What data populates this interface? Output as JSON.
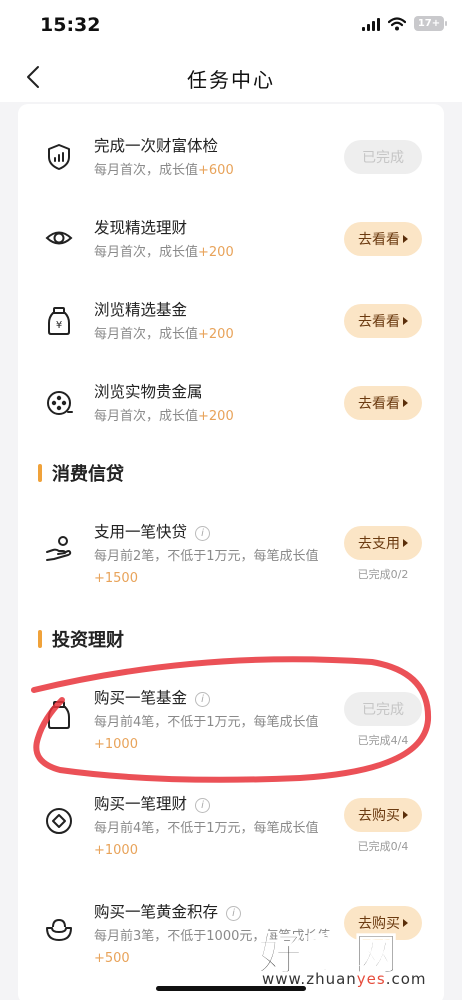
{
  "status_bar": {
    "time": "15:32",
    "battery": "17+"
  },
  "nav": {
    "title": "任务中心"
  },
  "sections": {
    "consumer_credit": "消费信贷",
    "investment": "投资理财"
  },
  "tasks": [
    {
      "title": "完成一次财富体检",
      "desc": "每月首次，成长值",
      "reward": "+600",
      "button": "已完成",
      "icon": "shield-chart-icon"
    },
    {
      "title": "发现精选理财",
      "desc": "每月首次，成长值",
      "reward": "+200",
      "button": "去看看",
      "icon": "eye-icon"
    },
    {
      "title": "浏览精选基金",
      "desc": "每月首次，成长值",
      "reward": "+200",
      "button": "去看看",
      "icon": "money-jar-icon"
    },
    {
      "title": "浏览实物贵金属",
      "desc": "每月首次，成长值",
      "reward": "+200",
      "button": "去看看",
      "icon": "film-reel-icon"
    },
    {
      "title": "支用一笔快贷",
      "desc": "每月前2笔，不低于1万元，每笔成长值",
      "reward": "+1500",
      "button": "去支用",
      "progress": "已完成0/2",
      "icon": "hand-coin-icon"
    },
    {
      "title": "购买一笔基金",
      "desc": "每月前4笔，不低于1万元，每笔成长值",
      "reward": "+1000",
      "button": "已完成",
      "progress": "已完成4/4",
      "icon": "jar-icon"
    },
    {
      "title": "购买一笔理财",
      "desc": "每月前4笔，不低于1万元，每笔成长值",
      "reward": "+1000",
      "button": "去购买",
      "progress": "已完成0/4",
      "icon": "coin-icon"
    },
    {
      "title": "购买一笔黄金积存",
      "desc": "每月前3笔，不低于1000元，每笔成长值",
      "reward": "+500",
      "button": "去购买",
      "icon": "gold-ingot-icon"
    }
  ],
  "watermark": {
    "big": "好赚网",
    "small_prefix": "www.zhuan",
    "small_highlight": "yes",
    "small_suffix": ".com"
  },
  "colors": {
    "accent": "#f0a23a",
    "reward": "#e8a35a",
    "button_bg": "#fbe5c6",
    "annotation": "#e8333a"
  }
}
